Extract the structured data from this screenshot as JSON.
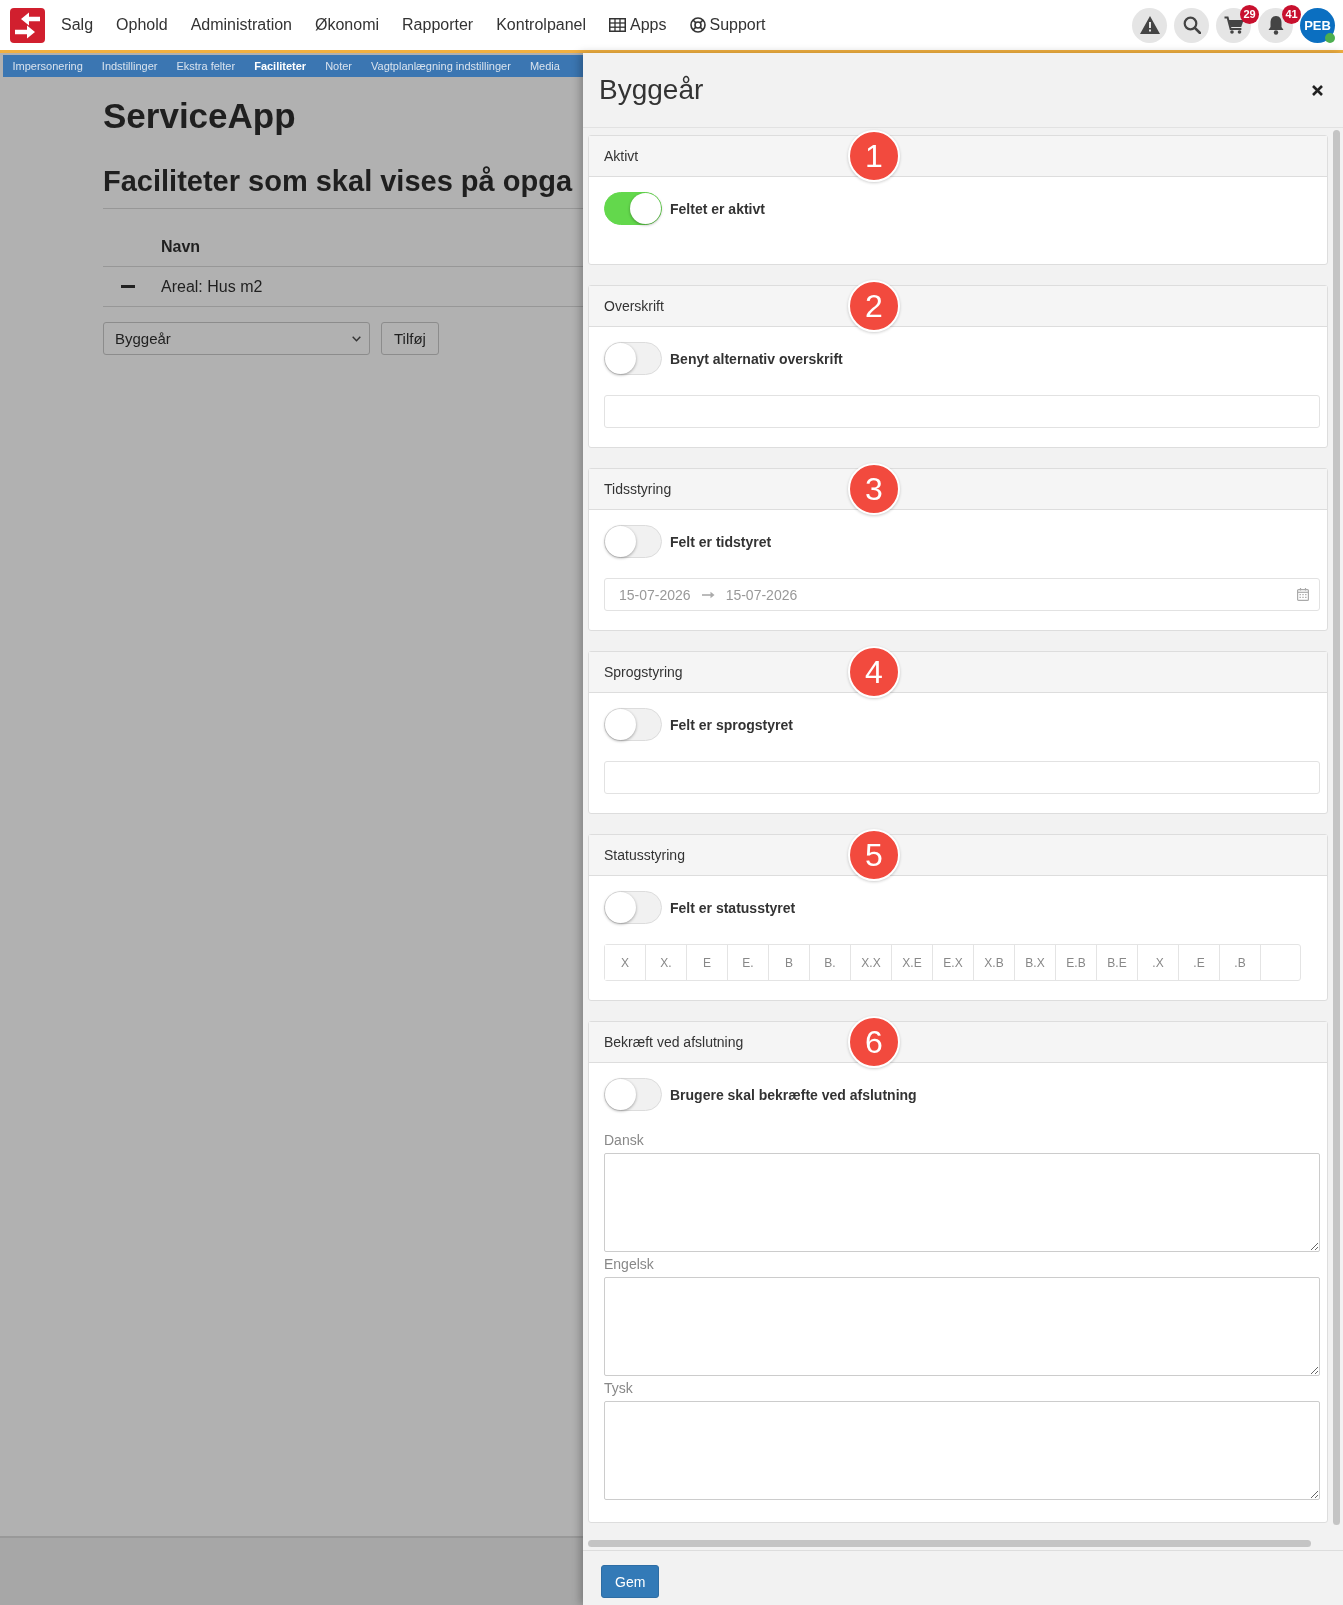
{
  "top_nav": {
    "items": [
      {
        "label": "Salg",
        "kind": "plain"
      },
      {
        "label": "Ophold",
        "kind": "plain"
      },
      {
        "label": "Administration",
        "kind": "plain"
      },
      {
        "label": "Økonomi",
        "kind": "plain"
      },
      {
        "label": "Rapporter",
        "kind": "plain"
      },
      {
        "label": "Kontrolpanel",
        "kind": "plain"
      },
      {
        "label": "Apps",
        "kind": "apps"
      },
      {
        "label": "Support",
        "kind": "support"
      }
    ]
  },
  "toolbar": {
    "actions": [
      {
        "kind": "alert"
      },
      {
        "kind": "search"
      },
      {
        "kind": "cart",
        "badge": "29"
      },
      {
        "kind": "notifications",
        "badge": "41"
      }
    ],
    "user": {
      "initials": "PEB",
      "online": true
    }
  },
  "sub_nav": {
    "items": [
      {
        "label": "Impersonering",
        "selected": false
      },
      {
        "label": "Indstillinger",
        "selected": false
      },
      {
        "label": "Ekstra felter",
        "selected": false
      },
      {
        "label": "Faciliteter",
        "selected": true
      },
      {
        "label": "Noter",
        "selected": false
      },
      {
        "label": "Vagtplanlægning indstillinger",
        "selected": false
      },
      {
        "label": "Media",
        "selected": false
      }
    ]
  },
  "page": {
    "title": "ServiceApp",
    "heading": "Faciliteter som skal vises på opga",
    "table": {
      "columns": [
        "Navn"
      ],
      "rows": [
        {
          "name": "Areal: Hus m2"
        }
      ]
    },
    "add_form": {
      "select_value": "Byggeår",
      "button": "Tilføj"
    }
  },
  "drawer": {
    "title": "Byggeår",
    "sections": [
      {
        "marker": "1",
        "title": "Aktivt",
        "toggle": {
          "label": "Feltet er aktivt",
          "on": true
        }
      },
      {
        "marker": "2",
        "title": "Overskrift",
        "toggle": {
          "label": "Benyt alternativ overskrift",
          "on": false
        },
        "field": {
          "kind": "text"
        }
      },
      {
        "marker": "3",
        "title": "Tidsstyring",
        "toggle": {
          "label": "Felt er tidstyret",
          "on": false
        },
        "field": {
          "kind": "daterange",
          "start": "15-07-2026",
          "end": "15-07-2026"
        }
      },
      {
        "marker": "4",
        "title": "Sprogstyring",
        "toggle": {
          "label": "Felt er sprogstyret",
          "on": false
        },
        "field": {
          "kind": "text"
        }
      },
      {
        "marker": "5",
        "title": "Statusstyring",
        "toggle": {
          "label": "Felt er statusstyret",
          "on": false
        },
        "field": {
          "kind": "statuses",
          "options": [
            "X",
            "X.",
            "E",
            "E.",
            "B",
            "B.",
            "X.X",
            "X.E",
            "E.X",
            "X.B",
            "B.X",
            "E.B",
            "B.E",
            ".X",
            ".E",
            ".B"
          ]
        }
      },
      {
        "marker": "6",
        "title": "Bekræft ved afslutning",
        "toggle": {
          "label": "Brugere skal bekræfte ved afslutning",
          "on": false
        },
        "field": {
          "kind": "translations",
          "languages": [
            {
              "label": "Dansk"
            },
            {
              "label": "Engelsk"
            },
            {
              "label": "Tysk"
            }
          ]
        }
      }
    ],
    "save_button": "Gem"
  }
}
